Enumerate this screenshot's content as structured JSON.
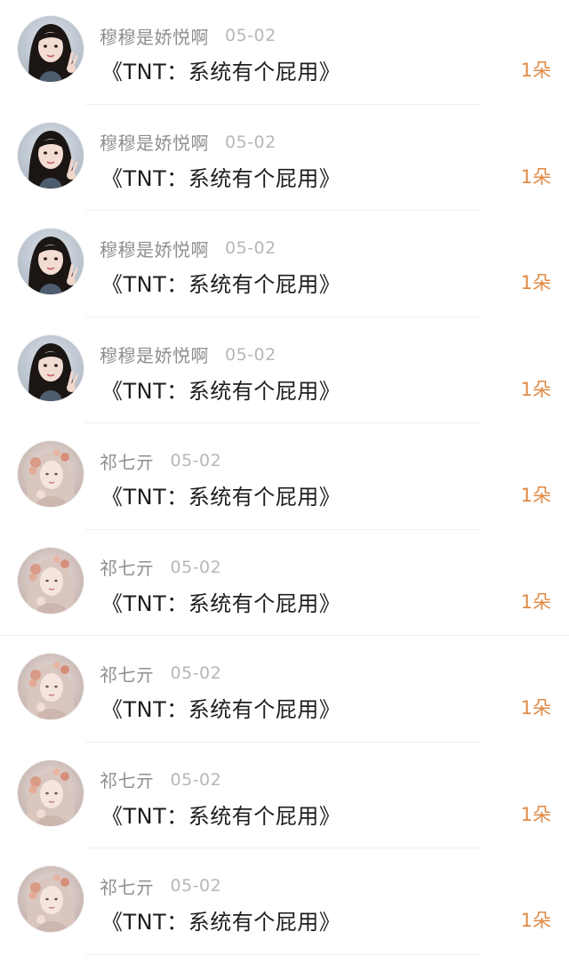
{
  "colors": {
    "background": "#ffffff",
    "username": "#8e8e8e",
    "date": "#b7b7b7",
    "message": "#1e1e1e",
    "gift": "#e08a45",
    "divider": "#f0f0f0"
  },
  "items": [
    {
      "avatar": "avatar-girl-peace-sign",
      "username": "穆穆是娇悦啊",
      "date": "05-02",
      "message": "《TNT：系统有个屁用》",
      "gift": "1朵"
    },
    {
      "avatar": "avatar-girl-peace-sign",
      "username": "穆穆是娇悦啊",
      "date": "05-02",
      "message": "《TNT：系统有个屁用》",
      "gift": "1朵"
    },
    {
      "avatar": "avatar-girl-peace-sign",
      "username": "穆穆是娇悦啊",
      "date": "05-02",
      "message": "《TNT：系统有个屁用》",
      "gift": "1朵"
    },
    {
      "avatar": "avatar-girl-peace-sign",
      "username": "穆穆是娇悦啊",
      "date": "05-02",
      "message": "《TNT：系统有个屁用》",
      "gift": "1朵"
    },
    {
      "avatar": "avatar-girl-with-flowers",
      "username": "祁七亓",
      "date": "05-02",
      "message": "《TNT：系统有个屁用》",
      "gift": "1朵"
    },
    {
      "avatar": "avatar-girl-with-flowers",
      "username": "祁七亓",
      "date": "05-02",
      "message": "《TNT：系统有个屁用》",
      "gift": "1朵"
    },
    {
      "avatar": "avatar-girl-with-flowers",
      "username": "祁七亓",
      "date": "05-02",
      "message": "《TNT：系统有个屁用》",
      "gift": "1朵"
    },
    {
      "avatar": "avatar-girl-with-flowers",
      "username": "祁七亓",
      "date": "05-02",
      "message": "《TNT：系统有个屁用》",
      "gift": "1朵"
    },
    {
      "avatar": "avatar-girl-with-flowers",
      "username": "祁七亓",
      "date": "05-02",
      "message": "《TNT：系统有个屁用》",
      "gift": "1朵"
    }
  ]
}
